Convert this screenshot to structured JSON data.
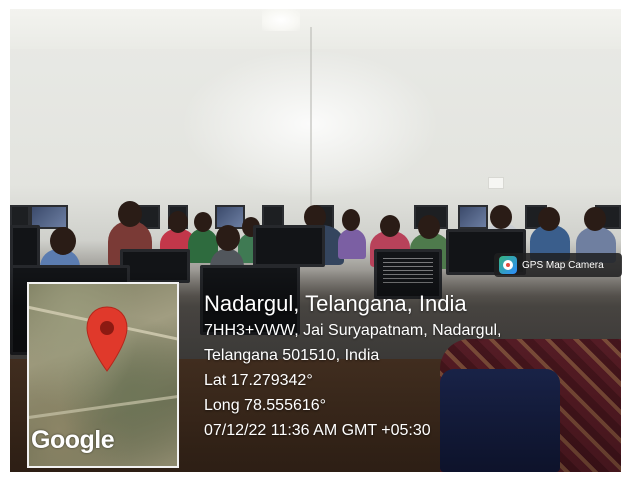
{
  "badge": {
    "icon": "gps-map-camera-icon",
    "label": "GPS Map Camera"
  },
  "location": {
    "title": "Nadargul, Telangana, India",
    "address_line1": "7HH3+VWW, Jai Suryapatnam, Nadargul,",
    "address_line2": "Telangana 501510, India",
    "latitude": "Lat 17.279342°",
    "longitude": "Long 78.555616°",
    "timestamp": "07/12/22 11:36 AM GMT +05:30"
  },
  "map": {
    "logo_text": "Google",
    "pin_icon": "map-pin-icon",
    "pin_color": "#e0392b"
  },
  "colors": {
    "text": "#ffffff",
    "badge_bg": "#1e1e20"
  }
}
